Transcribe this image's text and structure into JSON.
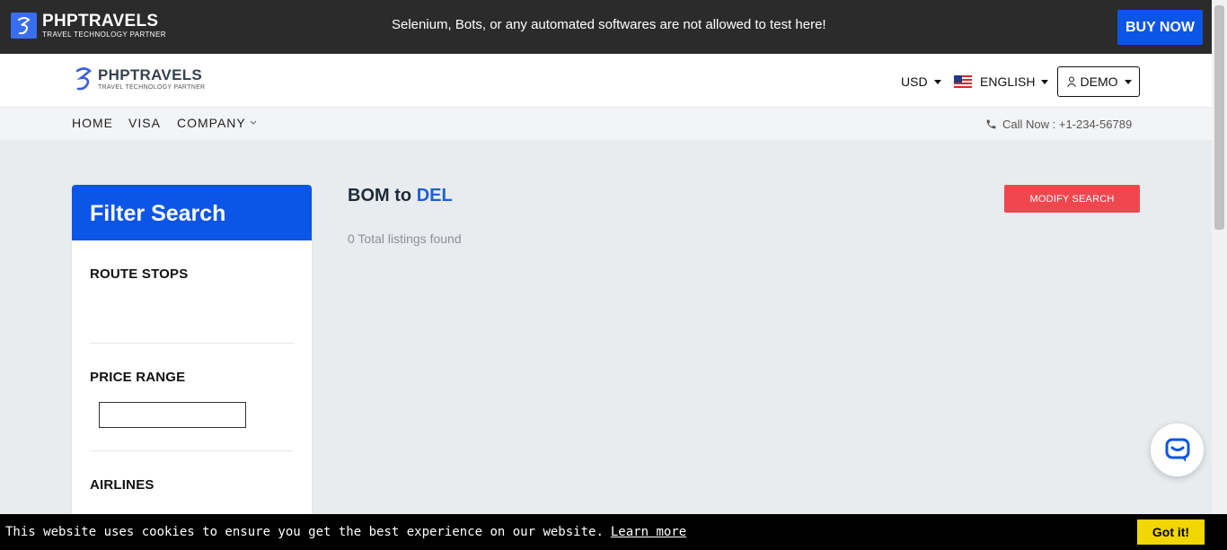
{
  "promo": {
    "logo_name": "PHPTRAVELS",
    "logo_tagline": "TRAVEL TECHNOLOGY PARTNER",
    "notice": "Selenium, Bots, or any automated softwares are not allowed to test here!",
    "buy_label": "BUY NOW"
  },
  "header": {
    "logo_name": "PHPTRAVELS",
    "logo_tagline": "TRAVEL TECHNOLOGY PARTNER",
    "currency": "USD",
    "language": "ENGLISH",
    "account": "DEMO"
  },
  "nav": {
    "items": [
      "HOME",
      "VISA",
      "COMPANY"
    ],
    "call": "Call Now : +1-234-56789"
  },
  "filter": {
    "title": "Filter Search",
    "route_stops": "ROUTE STOPS",
    "price_range": "PRICE RANGE",
    "price_value": "",
    "airlines": "AIRLINES"
  },
  "results": {
    "origin": "BOM",
    "connector": "to",
    "destination": "DEL",
    "count_text": "0 Total listings found",
    "modify_label": "MODIFY SEARCH"
  },
  "cookie": {
    "message": "This website uses cookies to ensure you get the best experience on our website.",
    "learn_more": "Learn more",
    "accept": "Got it!"
  },
  "colors": {
    "primary": "#0d55e6",
    "accent_red": "#f0474f",
    "promo_bg": "#2b2b2b",
    "cookie_button": "#f1d600"
  },
  "icons": [
    "phptravels-logo-icon",
    "caret-down-icon",
    "us-flag-icon",
    "user-icon",
    "chevron-down-icon",
    "phone-icon",
    "chat-icon"
  ]
}
